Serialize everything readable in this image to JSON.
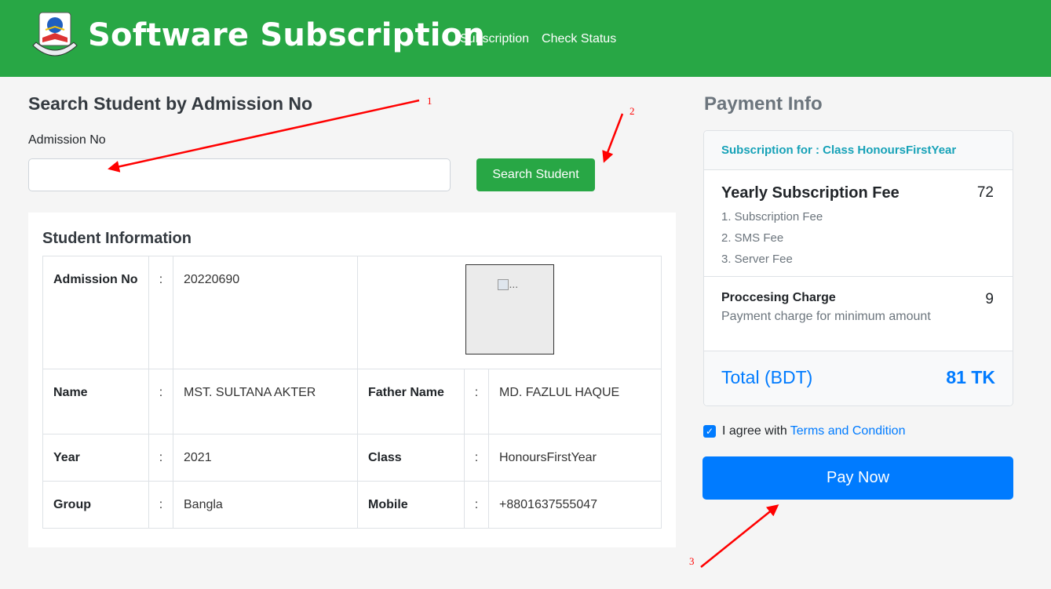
{
  "header": {
    "brand": "Software Subscription",
    "nav": [
      "Subscription",
      "Check Status"
    ],
    "color": "#28a745"
  },
  "search": {
    "title": "Search Student by Admission No",
    "label": "Admission No",
    "value": "",
    "button": "Search Student"
  },
  "student": {
    "title": "Student Information",
    "photo_alt": "...",
    "admission": {
      "label": "Admission No",
      "value": "20220690"
    },
    "rows": [
      {
        "k1": "Name",
        "v1": "MST. SULTANA AKTER",
        "k2": "Father Name",
        "v2": "MD. FAZLUL HAQUE"
      },
      {
        "k1": "Year",
        "v1": "2021",
        "k2": "Class",
        "v2": "HonoursFirstYear"
      },
      {
        "k1": "Group",
        "v1": "Bangla",
        "k2": "Mobile",
        "v2": "+8801637555047"
      }
    ],
    "separator": ":"
  },
  "payment": {
    "title": "Payment Info",
    "subscription_for": "Subscription for : Class HonoursFirstYear",
    "fee_title": "Yearly Subscription Fee",
    "fee_amount": "72",
    "fee_items": [
      "1. Subscription Fee",
      "2. SMS Fee",
      "3. Server Fee"
    ],
    "processing_title": "Proccesing Charge",
    "processing_desc": "Payment charge for minimum amount",
    "processing_amount": "9",
    "total_label": "Total (BDT)",
    "total_amount": "81 TK",
    "agree_text": "I agree with",
    "terms_link": "Terms and Condition",
    "agree_checked": true,
    "pay_button": "Pay Now",
    "accent": "#007bff"
  },
  "annotations": [
    "1",
    "2",
    "3"
  ]
}
